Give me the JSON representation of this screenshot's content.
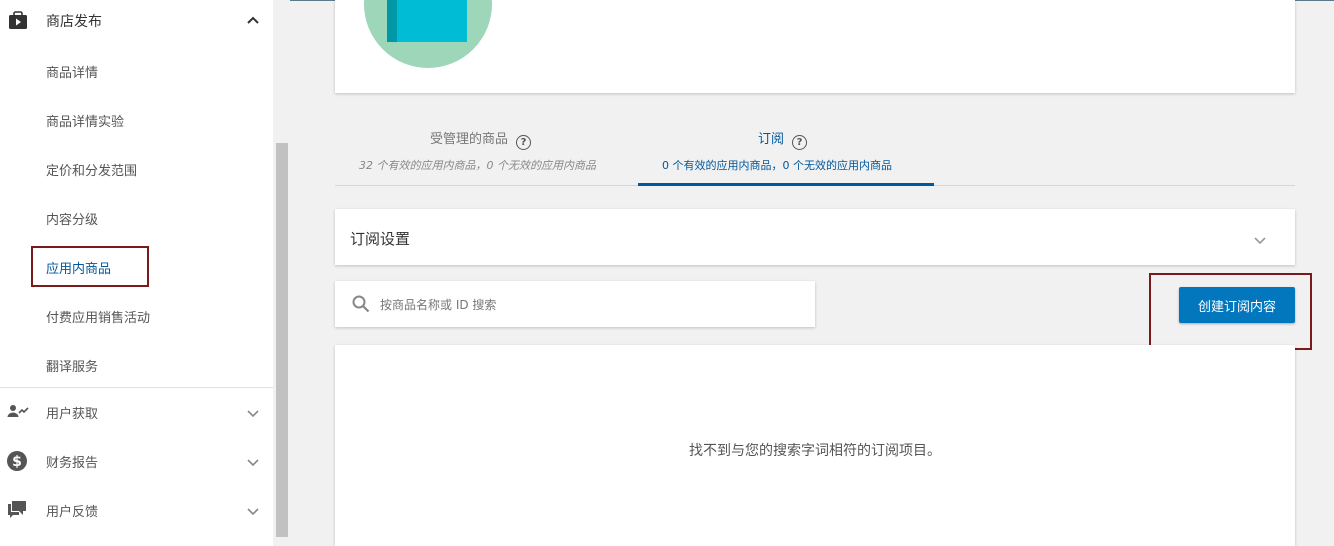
{
  "sidebar": {
    "section": {
      "label": "商店发布",
      "icon": "play-store-bag-icon",
      "expanded": true
    },
    "subitems": [
      {
        "label": "商品详情"
      },
      {
        "label": "商品详情实验"
      },
      {
        "label": "定价和分发范围"
      },
      {
        "label": "内容分级"
      },
      {
        "label": "应用内商品",
        "active": true
      },
      {
        "label": "付费应用销售活动"
      },
      {
        "label": "翻译服务"
      }
    ],
    "items": [
      {
        "label": "用户获取",
        "icon": "user-acquisition-icon"
      },
      {
        "label": "财务报告",
        "icon": "dollar-icon"
      },
      {
        "label": "用户反馈",
        "icon": "feedback-icon"
      }
    ]
  },
  "tabs": [
    {
      "title": "受管理的商品",
      "subtitle": "32 个有效的应用内商品，0 个无效的应用内商品",
      "active": false
    },
    {
      "title": "订阅",
      "subtitle": "0 个有效的应用内商品，0 个无效的应用内商品",
      "active": true
    }
  ],
  "settings": {
    "title": "订阅设置"
  },
  "search": {
    "placeholder": "按商品名称或 ID 搜索",
    "value": ""
  },
  "create_button": {
    "label": "创建订阅内容"
  },
  "results": {
    "empty_message": "找不到与您的搜索字词相符的订阅项目。"
  },
  "colors": {
    "accent": "#01579b",
    "button": "#0277bd",
    "highlight_box": "#7b1a1a"
  }
}
